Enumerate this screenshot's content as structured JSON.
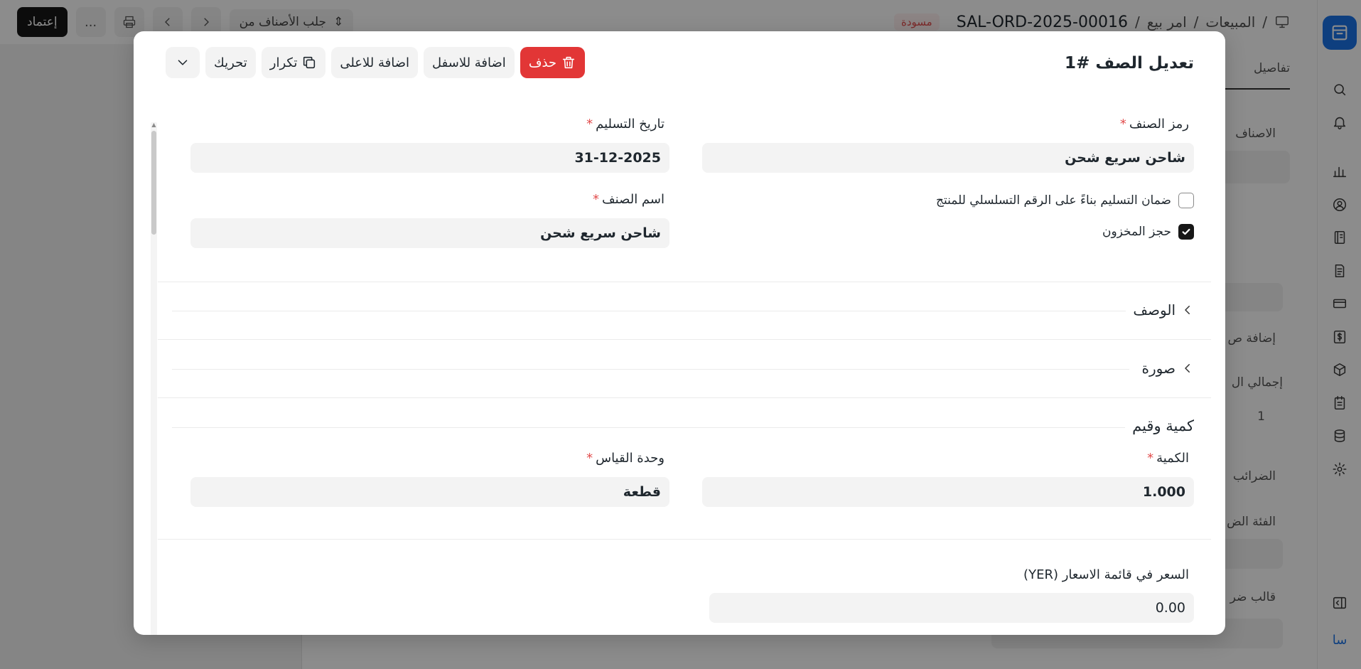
{
  "app": {
    "breadcrumbs": [
      "المبيعات",
      "امر بيع",
      "SAL-ORD-2025-00016"
    ],
    "separator": "/",
    "status": "مسودة",
    "fetch_items": "جلب الأصناف من",
    "more": "...",
    "submit": "إعتماد",
    "user_initials": "سا"
  },
  "background": {
    "tab_details": "تفاصيل",
    "items": "الاصناف",
    "add_row": "إضافة ص",
    "total": "إجمالي ال",
    "qty_value": "1",
    "taxes": "الضرائب",
    "tax_category": "الفئة الض",
    "tax_template": "قالب ضر"
  },
  "modal": {
    "title": "تعديل الصف #1",
    "buttons": {
      "delete": "حذف",
      "insert_below": "اضافة للاسفل",
      "insert_above": "اضافة للاعلى",
      "duplicate": "تكرار",
      "move": "تحريك"
    },
    "fields": {
      "item_code": {
        "label": "رمز الصنف",
        "value": "شاحن سريع شحن"
      },
      "delivery_date": {
        "label": "تاريخ التسليم",
        "value": "31-12-2025"
      },
      "item_name": {
        "label": "اسم الصنف",
        "value": "شاحن سريع شحن"
      },
      "ensure_delivery_serial": {
        "label": "ضمان التسليم بناءً على الرقم التسلسلي للمنتج",
        "checked": false
      },
      "reserve_stock": {
        "label": "حجز المخزون",
        "checked": true
      },
      "qty": {
        "label": "الكمية",
        "value": "1.000"
      },
      "uom": {
        "label": "وحدة القياس",
        "value": "قطعة"
      },
      "price_list_rate": {
        "label": "السعر في قائمة الاسعار (YER)",
        "value": "0.00"
      }
    },
    "required_mark": "*",
    "sections": {
      "description": "الوصف",
      "image": "صورة",
      "qty_rate": "كمية وقيم"
    }
  },
  "colors": {
    "brand": "#1a73e8",
    "danger": "#e23636",
    "required": "#e24c4c"
  }
}
